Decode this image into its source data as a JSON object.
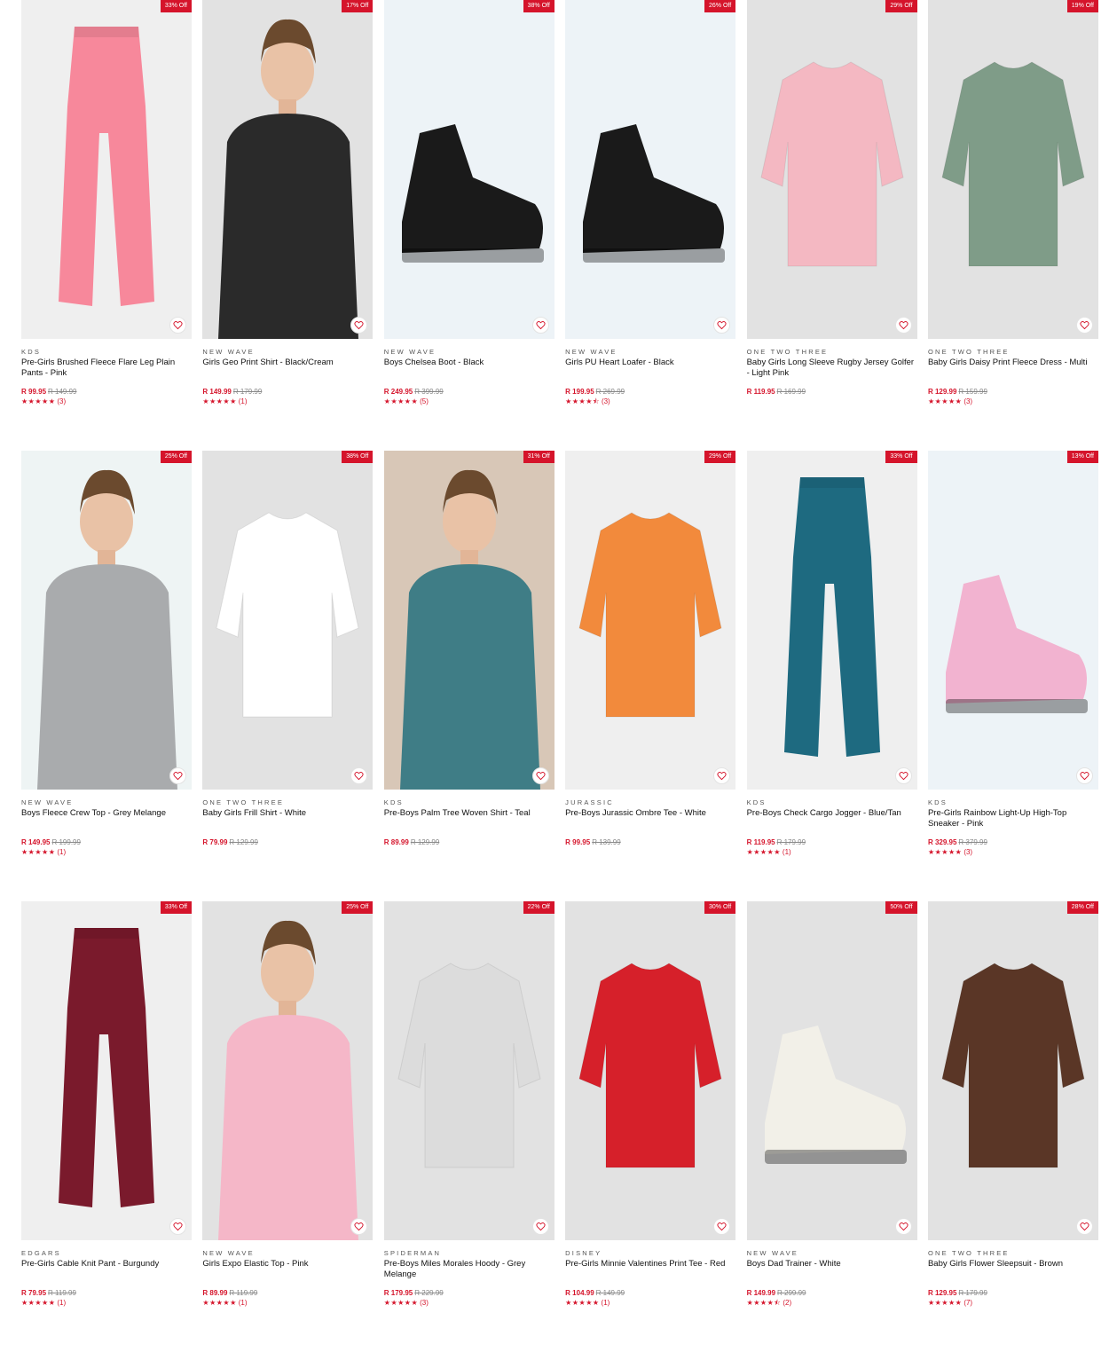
{
  "colors": {
    "accent": "#d5142b"
  },
  "products": [
    {
      "badge": "33% Off",
      "brand": "KDS",
      "title": "Pre-Girls Brushed Fleece Flare Leg Plain Pants - Pink",
      "price": "R 99.95",
      "was": "R 149.99",
      "stars": "★★★★★",
      "reviews": "(3)",
      "bg": "#efefef",
      "art": "pants",
      "color": "#f7889b"
    },
    {
      "badge": "17% Off",
      "brand": "NEW WAVE",
      "title": "Girls Geo Print Shirt - Black/Cream",
      "price": "R 149.99",
      "was": "R 179.99",
      "stars": "★★★★★",
      "reviews": "(1)",
      "bg": "#e2e2e2",
      "art": "person",
      "color": "#2a2a2a"
    },
    {
      "badge": "38% Off",
      "brand": "NEW WAVE",
      "title": "Boys Chelsea Boot - Black",
      "price": "R 249.95",
      "was": "R 399.99",
      "stars": "★★★★★",
      "reviews": "(5)",
      "bg": "#edf3f7",
      "art": "shoe",
      "color": "#1a1a1a"
    },
    {
      "badge": "26% Off",
      "brand": "NEW WAVE",
      "title": "Girls PU Heart Loafer - Black",
      "price": "R 199.95",
      "was": "R 269.99",
      "stars": "★★★★⯪",
      "reviews": "(3)",
      "bg": "#edf3f7",
      "art": "shoe",
      "color": "#1a1a1a"
    },
    {
      "badge": "29% Off",
      "brand": "ONE TWO THREE",
      "title": "Baby Girls Long Sleeve Rugby Jersey Golfer - Light Pink",
      "price": "R 119.95",
      "was": "R 169.99",
      "stars": "",
      "reviews": "",
      "bg": "#e2e2e2",
      "art": "top",
      "color": "#f4b8c2"
    },
    {
      "badge": "19% Off",
      "brand": "ONE TWO THREE",
      "title": "Baby Girls Daisy Print Fleece Dress - Multi",
      "price": "R 129.99",
      "was": "R 159.99",
      "stars": "★★★★★",
      "reviews": "(3)",
      "bg": "#e2e2e2",
      "art": "top",
      "color": "#7f9c88"
    },
    {
      "badge": "25% Off",
      "brand": "NEW WAVE",
      "title": "Boys Fleece Crew Top - Grey Melange",
      "price": "R 149.95",
      "was": "R 199.99",
      "stars": "★★★★★",
      "reviews": "(1)",
      "bg": "#eef4f4",
      "art": "person",
      "color": "#a9abad"
    },
    {
      "badge": "38% Off",
      "brand": "ONE TWO THREE",
      "title": "Baby Girls Frill Shirt - White",
      "price": "R 79.99",
      "was": "R 129.99",
      "stars": "",
      "reviews": "",
      "bg": "#e2e2e2",
      "art": "top",
      "color": "#ffffff"
    },
    {
      "badge": "31% Off",
      "brand": "KDS",
      "title": "Pre-Boys Palm Tree Woven Shirt - Teal",
      "price": "R 89.99",
      "was": "R 129.99",
      "stars": "",
      "reviews": "",
      "bg": "#d8c7b7",
      "art": "person",
      "color": "#3f7d86"
    },
    {
      "badge": "29% Off",
      "brand": "JURASSIC",
      "title": "Pre-Boys Jurassic Ombre Tee - White",
      "price": "R 99.95",
      "was": "R 139.99",
      "stars": "",
      "reviews": "",
      "bg": "#efefef",
      "art": "top",
      "color": "#f28a3c"
    },
    {
      "badge": "33% Off",
      "brand": "KDS",
      "title": "Pre-Boys Check Cargo Jogger - Blue/Tan",
      "price": "R 119.95",
      "was": "R 179.99",
      "stars": "★★★★★",
      "reviews": "(1)",
      "bg": "#efefef",
      "art": "pants",
      "color": "#1e6a80"
    },
    {
      "badge": "13% Off",
      "brand": "KDS",
      "title": "Pre-Girls Rainbow Light-Up High-Top Sneaker - Pink",
      "price": "R 329.95",
      "was": "R 379.99",
      "stars": "★★★★★",
      "reviews": "(3)",
      "bg": "#edf3f7",
      "art": "shoe",
      "color": "#f2b3d0"
    },
    {
      "badge": "33% Off",
      "brand": "EDGARS",
      "title": "Pre-Girls Cable Knit Pant - Burgundy",
      "price": "R 79.95",
      "was": "R 119.99",
      "stars": "★★★★★",
      "reviews": "(1)",
      "bg": "#efefef",
      "art": "pants",
      "color": "#7a1a2c"
    },
    {
      "badge": "25% Off",
      "brand": "NEW WAVE",
      "title": "Girls Expo Elastic Top - Pink",
      "price": "R 89.99",
      "was": "R 119.99",
      "stars": "★★★★★",
      "reviews": "(1)",
      "bg": "#e2e2e2",
      "art": "person",
      "color": "#f5b7c8"
    },
    {
      "badge": "22% Off",
      "brand": "SPIDERMAN",
      "title": "Pre-Boys Miles Morales Hoody - Grey Melange",
      "price": "R 179.95",
      "was": "R 229.99",
      "stars": "★★★★★",
      "reviews": "(3)",
      "bg": "#e2e2e2",
      "art": "top",
      "color": "#dcdcdc"
    },
    {
      "badge": "30% Off",
      "brand": "DISNEY",
      "title": "Pre-Girls Minnie Valentines Print Tee - Red",
      "price": "R 104.99",
      "was": "R 149.99",
      "stars": "★★★★★",
      "reviews": "(1)",
      "bg": "#e2e2e2",
      "art": "top",
      "color": "#d6202a"
    },
    {
      "badge": "50% Off",
      "brand": "NEW WAVE",
      "title": "Boys Dad Trainer - White",
      "price": "R 149.99",
      "was": "R 299.99",
      "stars": "★★★★⯪",
      "reviews": "(2)",
      "bg": "#e2e2e2",
      "art": "shoe",
      "color": "#f2f0e8"
    },
    {
      "badge": "28% Off",
      "brand": "ONE TWO THREE",
      "title": "Baby Girls Flower Sleepsuit - Brown",
      "price": "R 129.95",
      "was": "R 179.99",
      "stars": "★★★★★",
      "reviews": "(7)",
      "bg": "#e2e2e2",
      "art": "top",
      "color": "#5a3626"
    }
  ]
}
